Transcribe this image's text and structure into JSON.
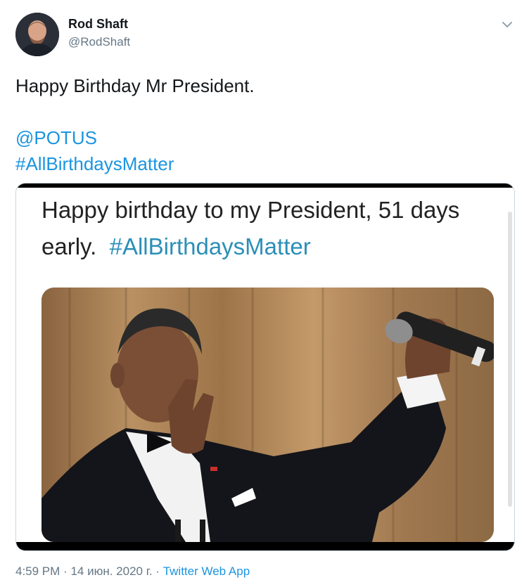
{
  "author": {
    "name": "Rod Shaft",
    "handle": "@RodShaft"
  },
  "tweet": {
    "line1": "Happy Birthday Mr President.",
    "mention": "@POTUS",
    "hashtag": "#AllBirthdaysMatter"
  },
  "media": {
    "caption_line1": "Happy birthday to my President, 51 days",
    "caption_line2_prefix": "early.",
    "caption_hashtag": "#AllBirthdaysMatter"
  },
  "footer": {
    "time": "4:59 PM",
    "separator": "·",
    "date": "14 июн. 2020 г.",
    "app": "Twitter Web App"
  },
  "colors": {
    "link": "#1b95e0",
    "secondary_text": "#657786",
    "caption_hashtag": "#2b8fb8"
  },
  "icons": {
    "menu": "chevron-down-icon"
  }
}
